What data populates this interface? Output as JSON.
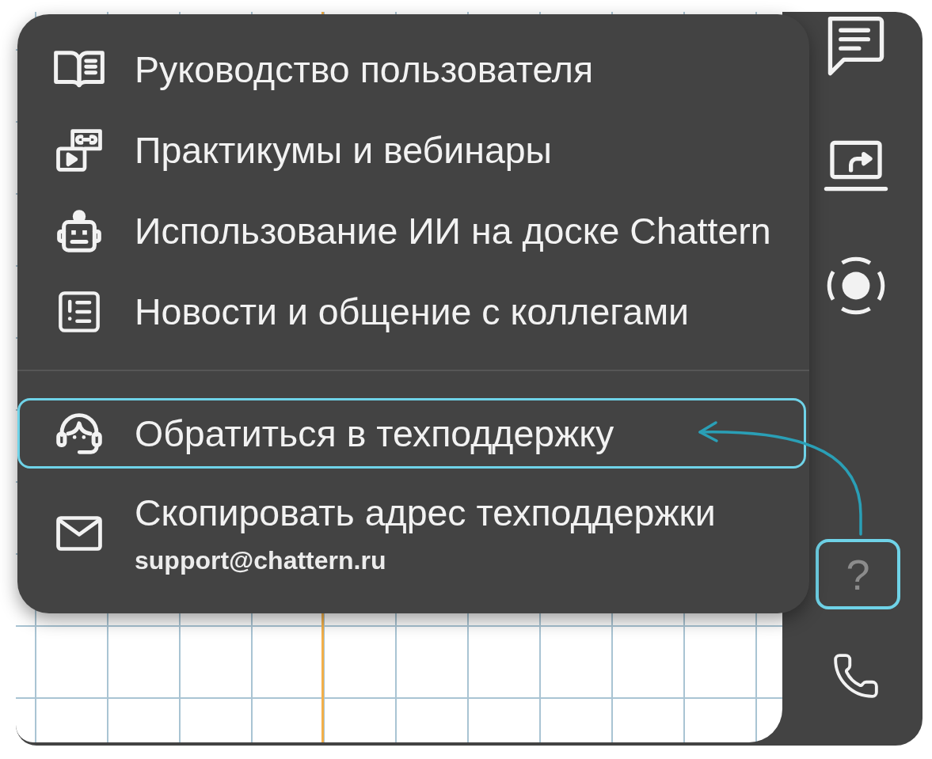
{
  "help_menu": {
    "sections": [
      {
        "items": [
          {
            "label": "Руководство пользователя",
            "highlighted": false
          },
          {
            "label": "Практикумы и вебинары",
            "highlighted": false
          },
          {
            "label": "Использование ИИ на доске Chattern",
            "highlighted": false
          },
          {
            "label": "Новости и общение с коллегами",
            "highlighted": false
          }
        ]
      },
      {
        "items": [
          {
            "label": "Обратиться в техподдержку",
            "highlighted": true
          },
          {
            "label": "Скопировать адрес техподдержки",
            "subtitle": "support@chattern.ru",
            "highlighted": false
          }
        ]
      }
    ]
  },
  "side_toolbar": {
    "help_button": {
      "label": "?",
      "highlighted": true
    }
  }
}
